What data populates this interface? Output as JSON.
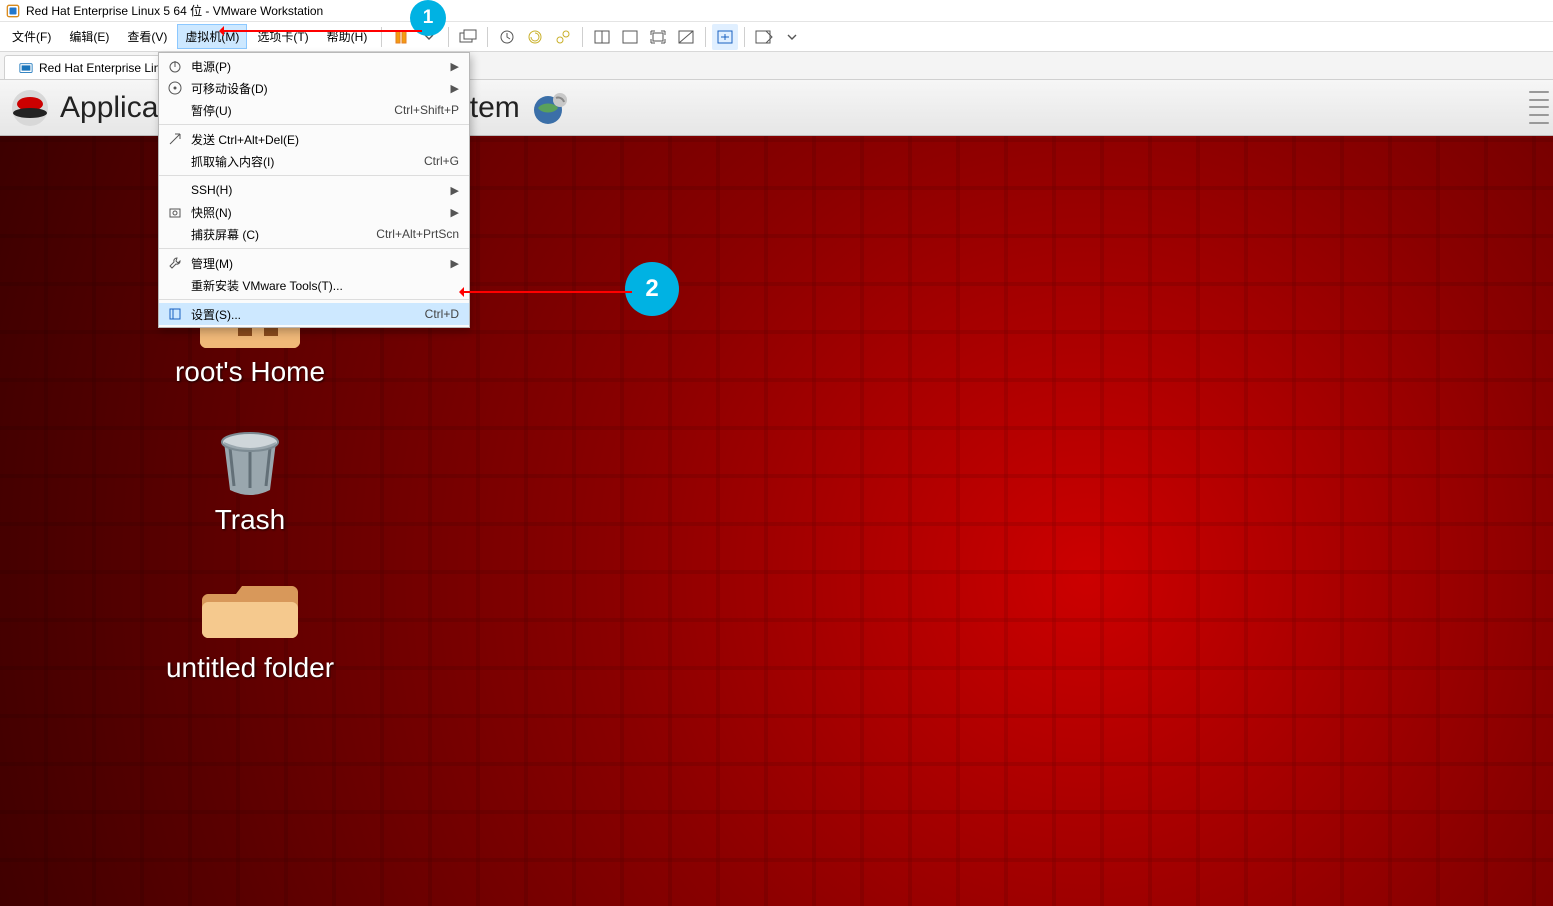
{
  "window": {
    "title": "Red Hat Enterprise Linux 5 64 位 - VMware Workstation"
  },
  "menubar": {
    "file": "文件(F)",
    "edit": "编辑(E)",
    "view": "查看(V)",
    "vm": "虚拟机(M)",
    "tabs": "选项卡(T)",
    "help": "帮助(H)"
  },
  "tab": {
    "label": "Red Hat Enterprise Linux",
    "close": "×"
  },
  "gnome_panel": {
    "applications": "Applications",
    "system": "System"
  },
  "desktop": {
    "root_home": "root's Home",
    "trash": "Trash",
    "untitled_folder": "untitled folder"
  },
  "dropdown": {
    "power": {
      "label": "电源(P)"
    },
    "removable": {
      "label": "可移动设备(D)"
    },
    "pause": {
      "label": "暂停(U)",
      "accel": "Ctrl+Shift+P"
    },
    "send_cad": {
      "label": "发送 Ctrl+Alt+Del(E)"
    },
    "grab": {
      "label": "抓取输入内容(I)",
      "accel": "Ctrl+G"
    },
    "ssh": {
      "label": "SSH(H)"
    },
    "snapshot": {
      "label": "快照(N)"
    },
    "capture": {
      "label": "捕获屏幕 (C)",
      "accel": "Ctrl+Alt+PrtScn"
    },
    "manage": {
      "label": "管理(M)"
    },
    "reinstall": {
      "label": "重新安装 VMware Tools(T)..."
    },
    "settings": {
      "label": "设置(S)...",
      "accel": "Ctrl+D"
    }
  },
  "annotations": {
    "badge1": "1",
    "badge2": "2"
  }
}
